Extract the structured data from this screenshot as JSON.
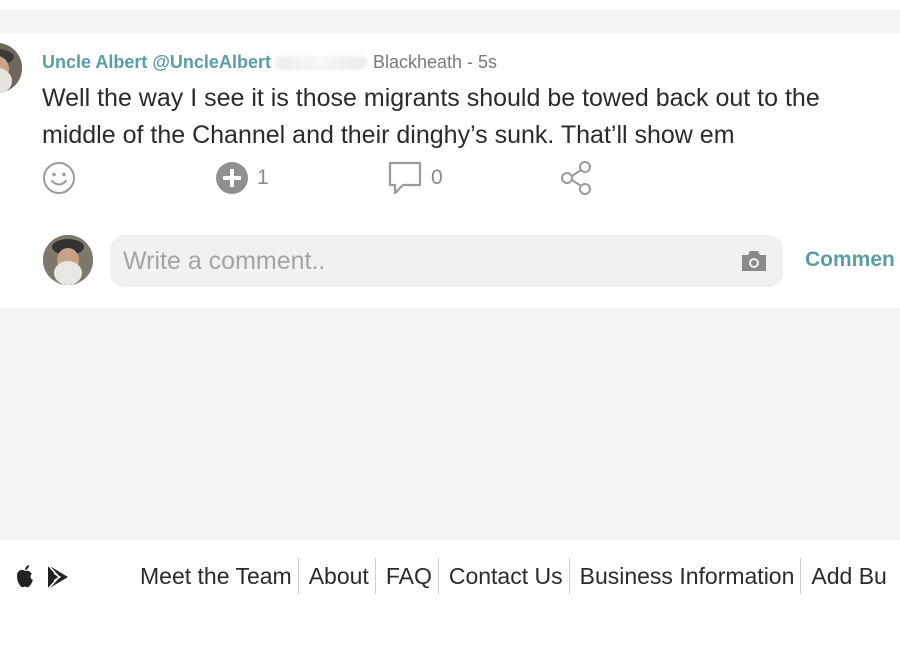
{
  "post": {
    "author_name": "Uncle Albert",
    "author_handle": "@UncleAlbert",
    "location_time": "Blackheath - 5s",
    "text": "Well the way I see it is those migrants should be towed back out to the middle of the Channel and their dinghy’s sunk. That’ll show em",
    "actions": {
      "react_icon": "smiley-icon",
      "plus_icon": "plus-circle-icon",
      "plus_count": "1",
      "comment_icon": "speech-bubble-icon",
      "comment_count": "0",
      "share_icon": "share-icon"
    }
  },
  "comment_form": {
    "placeholder": "Write a comment..",
    "camera_icon": "camera-icon",
    "submit_label": "Commen"
  },
  "footer": {
    "store_icons": [
      "apple-icon",
      "google-play-icon"
    ],
    "links": [
      "Meet the Team",
      "About",
      "FAQ",
      "Contact Us",
      "Business Information",
      "Add Bu"
    ]
  },
  "colors": {
    "accent": "#5a9ea5",
    "text": "#2b2b2b",
    "muted": "#8a8a8a",
    "page_bg": "#f5f5f5"
  }
}
